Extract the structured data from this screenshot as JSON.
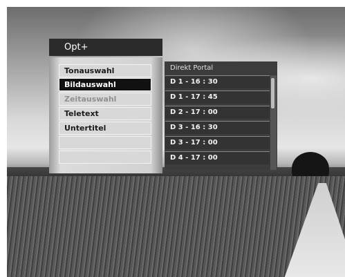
{
  "menu": {
    "title": "Opt+",
    "items": [
      {
        "label": "Tonauswahl",
        "state": "normal"
      },
      {
        "label": "Bildauswahl",
        "state": "selected"
      },
      {
        "label": "Zeitauswahl",
        "state": "disabled"
      },
      {
        "label": "Teletext",
        "state": "normal"
      },
      {
        "label": "Untertitel",
        "state": "normal"
      }
    ]
  },
  "portal": {
    "title": "Direkt Portal",
    "items": [
      "D 1 - 16 : 30",
      "D 1 - 17 : 45",
      "D 2 - 17 : 00",
      "D 3 - 16 : 30",
      "D 3 - 17 : 00",
      "D 4 - 17 : 00"
    ]
  }
}
